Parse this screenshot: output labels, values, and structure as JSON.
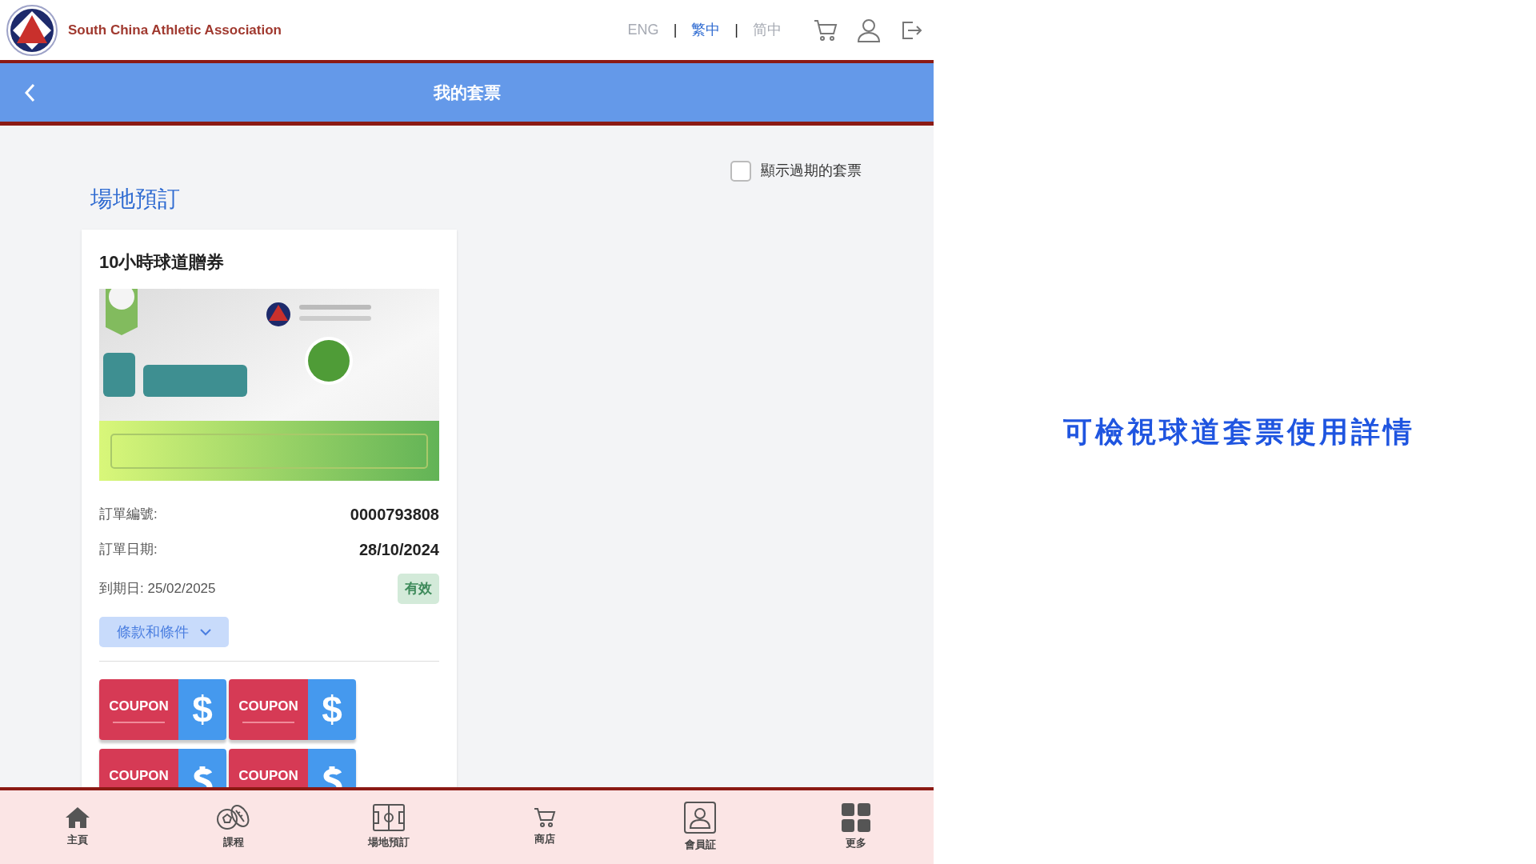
{
  "header": {
    "title": "South China Athletic Association",
    "languages": [
      {
        "label": "ENG",
        "selected": false
      },
      {
        "label": "繁中",
        "selected": true
      },
      {
        "label": "简中",
        "selected": false
      }
    ],
    "separators": [
      "|",
      "|"
    ]
  },
  "title_bar": {
    "title": "我的套票"
  },
  "filter": {
    "label": "顯示過期的套票",
    "checked": false
  },
  "section": {
    "title": "場地預訂"
  },
  "card": {
    "title": "10小時球道贈券",
    "rows": [
      {
        "label": "訂單編號:",
        "value": "0000793808"
      },
      {
        "label": "訂單日期:",
        "value": "28/10/2024"
      }
    ],
    "expiry": "到期日: 25/02/2025",
    "status": {
      "label": "有效",
      "color": "#3d8a5a"
    },
    "terms_button": "條款和條件",
    "coupons": [
      {
        "label": "COUPON",
        "symbol": "$"
      },
      {
        "label": "COUPON",
        "symbol": "$"
      },
      {
        "label": "COUPON"
      },
      {
        "label": "COUPON"
      }
    ]
  },
  "bottom_nav": [
    {
      "label": "主頁"
    },
    {
      "label": "課程"
    },
    {
      "label": "場地預訂"
    },
    {
      "label": "商店"
    },
    {
      "label": "會員証"
    },
    {
      "label": "更多"
    }
  ],
  "caption": "可檢視球道套票使用詳情"
}
